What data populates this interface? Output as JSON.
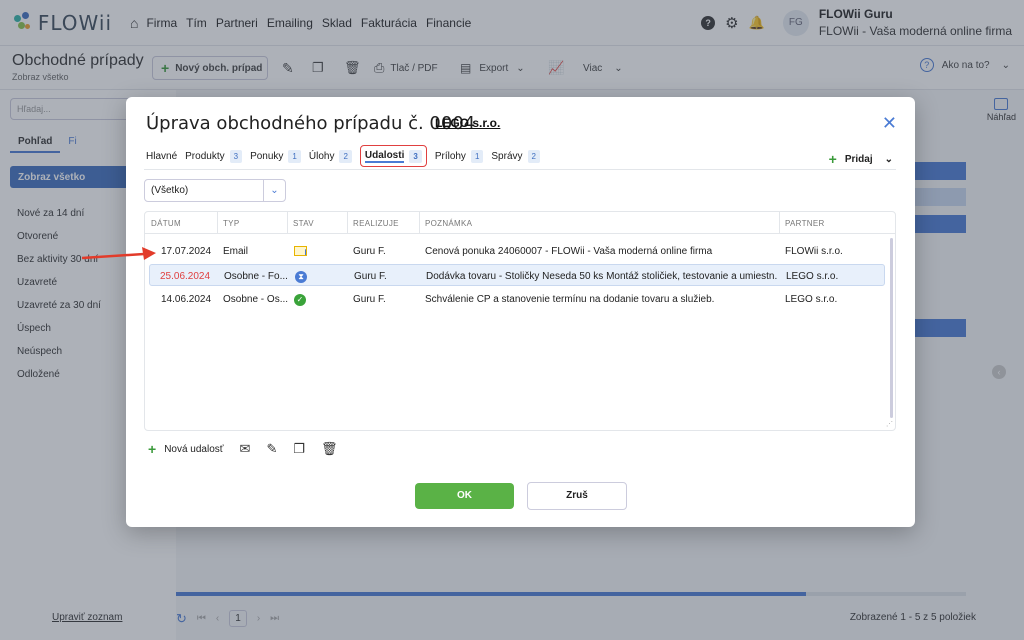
{
  "app": {
    "logo_text": "FLOWii",
    "nav": [
      "Firma",
      "Tím",
      "Partneri",
      "Emailing",
      "Sklad",
      "Fakturácia",
      "Financie"
    ],
    "help_icon_glyph": "?",
    "user": {
      "initials": "FG",
      "name": "FLOWii Guru",
      "company": "FLOWii - Vaša moderná online firma"
    }
  },
  "toolbar": {
    "title": "Obchodné prípady",
    "subtitle": "Zobraz všetko",
    "new_case": "Nový obch. prípad",
    "print_pdf": "Tlač / PDF",
    "export": "Export",
    "more": "Viac",
    "how_to": "Ako na to?",
    "how_to_icon_glyph": "?"
  },
  "sidebar": {
    "search_placeholder": "Hľadaj...",
    "view_tabs": [
      "Pohľad",
      "Fi"
    ],
    "active_item": "Zobraz všetko",
    "items": [
      "Nové za 14 dní",
      "Otvorené",
      "Bez aktivity 30 dní",
      "Uzavreté",
      "Uzavreté za 30 dní",
      "Úspech",
      "Neúspech",
      "Odložené"
    ],
    "footer_link": "Upraviť zoznam"
  },
  "main": {
    "preview_label": "Náhľad",
    "pager": {
      "page": "1",
      "info": "Zobrazené 1 - 5 z 5 položiek"
    }
  },
  "modal": {
    "title": "Úprava obchodného prípadu č. 0004",
    "partner": "LEGO s.r.o.",
    "tabs": [
      {
        "label": "Hlavné",
        "badge": ""
      },
      {
        "label": "Produkty",
        "badge": "3"
      },
      {
        "label": "Ponuky",
        "badge": "1"
      },
      {
        "label": "Úlohy",
        "badge": "2"
      },
      {
        "label": "Udalosti",
        "badge": "3"
      },
      {
        "label": "Prílohy",
        "badge": "1"
      },
      {
        "label": "Správy",
        "badge": "2"
      }
    ],
    "add_label": "Pridaj",
    "filter_value": "(Všetko)",
    "columns": [
      "DÁTUM",
      "TYP",
      "STAV",
      "REALIZUJE",
      "POZNÁMKA",
      "PARTNER"
    ],
    "rows": [
      {
        "date": "17.07.2024",
        "type": "Email",
        "status": "email-sent",
        "by": "Guru F.",
        "note": "Cenová ponuka 24060007 - FLOWii - Vaša moderná online firma",
        "partner": "FLOWii s.r.o."
      },
      {
        "date": "25.06.2024",
        "type": "Osobne - Fo...",
        "status": "waiting",
        "by": "Guru F.",
        "note": "Dodávka tovaru - Stoličky Neseda 50 ks Montáž stoličiek, testovanie a umiestn...",
        "partner": "LEGO s.r.o."
      },
      {
        "date": "14.06.2024",
        "type": "Osobne - Os...",
        "status": "done",
        "by": "Guru F.",
        "note": "Schválenie CP a stanovenie termínu na dodanie tovaru a služieb.",
        "partner": "LEGO s.r.o."
      }
    ],
    "new_event": "Nová udalosť",
    "ok": "OK",
    "cancel": "Zruš"
  },
  "colors": {
    "accent": "#4a7bd4",
    "ok": "#5ab246",
    "highlight": "#e04040"
  }
}
